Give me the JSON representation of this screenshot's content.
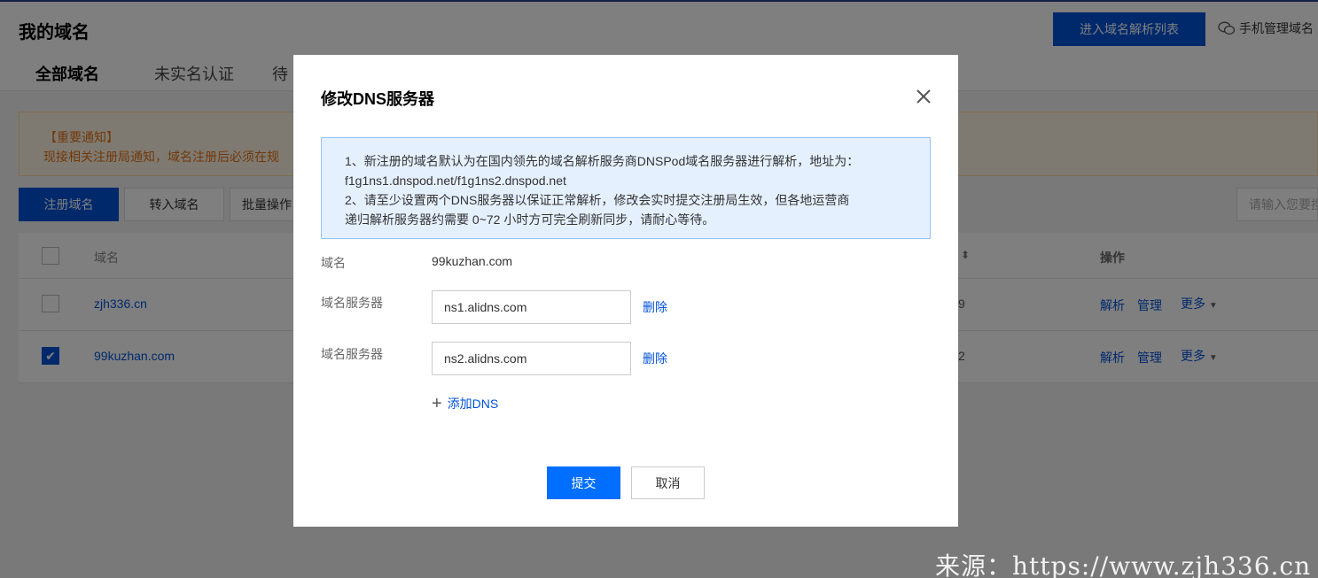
{
  "header": {
    "title": "我的域名",
    "parse_list_button": "进入域名解析列表",
    "mobile_manage": "手机管理域名"
  },
  "tabs": [
    {
      "label": "全部域名",
      "active": true
    },
    {
      "label": "未实名认证",
      "active": false
    },
    {
      "label": "待",
      "active": false
    }
  ],
  "notice": {
    "title": "【重要通知】",
    "text": "现接相关注册局通知，域名注册后必须在规"
  },
  "toolbar": {
    "register_button": "注册域名",
    "transfer_button": "转入域名",
    "batch_button": "批量操作",
    "search_placeholder": "请输入您要搜"
  },
  "table": {
    "headers": {
      "domain": "域名",
      "operations": "操作"
    },
    "rows": [
      {
        "domain": "zjh336.cn",
        "checked": false,
        "value_fragment": "9",
        "actions": [
          "解析",
          "管理",
          "更多"
        ]
      },
      {
        "domain": "99kuzhan.com",
        "checked": true,
        "value_fragment": "2",
        "actions": [
          "解析",
          "管理",
          "更多"
        ]
      }
    ]
  },
  "modal": {
    "title": "修改DNS服务器",
    "info_line1": "1、新注册的域名默认为在国内领先的域名解析服务商DNSPod域名服务器进行解析，地址为：",
    "info_line2": "f1g1ns1.dnspod.net/f1g1ns2.dnspod.net",
    "info_line3": "2、请至少设置两个DNS服务器以保证正常解析，修改会实时提交注册局生效，但各地运营商",
    "info_line4": "递归解析服务器约需要 0~72 小时方可完全刷新同步，请耐心等待。",
    "domain_label": "域名",
    "domain_value": "99kuzhan.com",
    "nameservers": [
      {
        "label": "域名服务器",
        "value": "ns1.alidns.com",
        "delete": "删除"
      },
      {
        "label": "域名服务器",
        "value": "ns2.alidns.com",
        "delete": "删除"
      }
    ],
    "add_dns": "添加DNS",
    "submit": "提交",
    "cancel": "取消"
  },
  "watermark": "来源：https://www.zjh336.cn"
}
